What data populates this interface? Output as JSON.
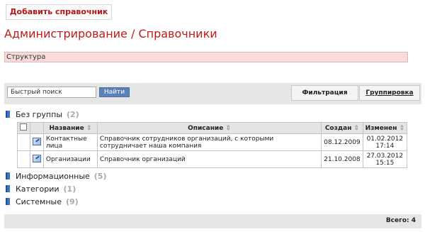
{
  "toolbar": {
    "add_label": "Добавить справочник"
  },
  "page": {
    "title": "Администрирование / Справочники"
  },
  "structure": {
    "label": "Структура"
  },
  "search": {
    "placeholder": "Быстрый поиск",
    "button": "Найти"
  },
  "tabs": {
    "filter": "Фильтрация",
    "grouping": "Группировка"
  },
  "groups": [
    {
      "name": "Без группы",
      "count": "(2)"
    },
    {
      "name": "Информационные",
      "count": "(5)"
    },
    {
      "name": "Категории",
      "count": "(1)"
    },
    {
      "name": "Системные",
      "count": "(9)"
    }
  ],
  "table": {
    "columns": {
      "name": "Название",
      "description": "Описание",
      "created": "Создан",
      "modified": "Изменен"
    },
    "rows": [
      {
        "name": "Контактные лица",
        "description": "Справочник сотрудников организаций, с которыми сотрудничает наша компания",
        "created": "08.12.2009",
        "modified_date": "01.02.2012",
        "modified_time": "17:14"
      },
      {
        "name": "Организации",
        "description": "Справочник организаций",
        "created": "21.10.2008",
        "modified_date": "27.03.2012",
        "modified_time": "15:15"
      }
    ]
  },
  "footer": {
    "total": "Всего: 4"
  },
  "icons": {
    "folder": "folder-icon",
    "edit": "edit-icon",
    "sort": "sort-icon"
  },
  "colors": {
    "accent": "#c21a1a",
    "button": "#5b82b8",
    "structure_bg": "#f8dcdc"
  }
}
